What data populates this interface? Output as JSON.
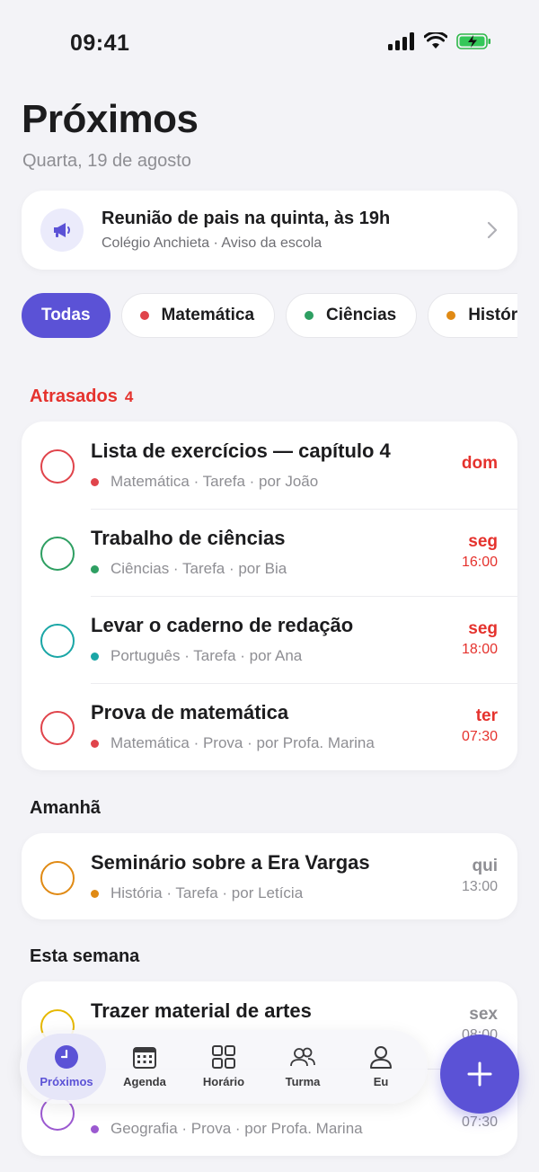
{
  "status_bar": {
    "time": "09:41"
  },
  "header": {
    "title": "Próximos",
    "date": "Quarta, 19 de agosto"
  },
  "notice": {
    "title": "Reunião de pais na quinta, às 19h",
    "subtitle": "Colégio Anchieta · Aviso da escola",
    "icon": "megaphone-icon"
  },
  "filters": [
    {
      "label": "Todas",
      "active": true
    },
    {
      "label": "Matemática",
      "color": "#e0444b"
    },
    {
      "label": "Ciências",
      "color": "#2e9f62"
    },
    {
      "label": "História",
      "color": "#e08a14"
    }
  ],
  "sections": {
    "overdue": {
      "title": "Atrasados",
      "count": "4",
      "items": [
        {
          "title": "Lista de exercícios — capítulo 4",
          "meta": "Matemática · Tarefa · por João",
          "day": "dom",
          "time": "",
          "color": "#e0444b"
        },
        {
          "title": "Trabalho de ciências",
          "meta": "Ciências · Tarefa · por Bia",
          "day": "seg",
          "time": "16:00",
          "color": "#2e9f62"
        },
        {
          "title": "Levar o caderno de redação",
          "meta": "Português · Tarefa · por Ana",
          "day": "seg",
          "time": "18:00",
          "color": "#1aa6a6"
        },
        {
          "title": "Prova de matemática",
          "meta": "Matemática · Prova · por Profa. Marina",
          "day": "ter",
          "time": "07:30",
          "color": "#e0444b"
        }
      ]
    },
    "tomorrow": {
      "title": "Amanhã",
      "items": [
        {
          "title": "Seminário sobre a Era Vargas",
          "meta": "História · Tarefa · por Letícia",
          "day": "qui",
          "time": "13:00",
          "color": "#e08a14"
        }
      ]
    },
    "week": {
      "title": "Esta semana",
      "items": [
        {
          "title": "Trazer material de artes",
          "meta": "",
          "day": "sex",
          "time": "08:00",
          "color": "#e6b800"
        },
        {
          "title": "",
          "meta": "Geografia · Prova · por Profa. Marina",
          "day": "",
          "time": "07:30",
          "color": "#9b59d0"
        }
      ]
    }
  },
  "tabbar": [
    {
      "label": "Próximos",
      "icon": "clock-icon",
      "active": true
    },
    {
      "label": "Agenda",
      "icon": "calendar-icon"
    },
    {
      "label": "Horário",
      "icon": "grid-icon"
    },
    {
      "label": "Turma",
      "icon": "people-icon"
    },
    {
      "label": "Eu",
      "icon": "person-icon"
    }
  ],
  "colors": {
    "accent": "#5b52d6",
    "overdue": "#e5322d"
  }
}
